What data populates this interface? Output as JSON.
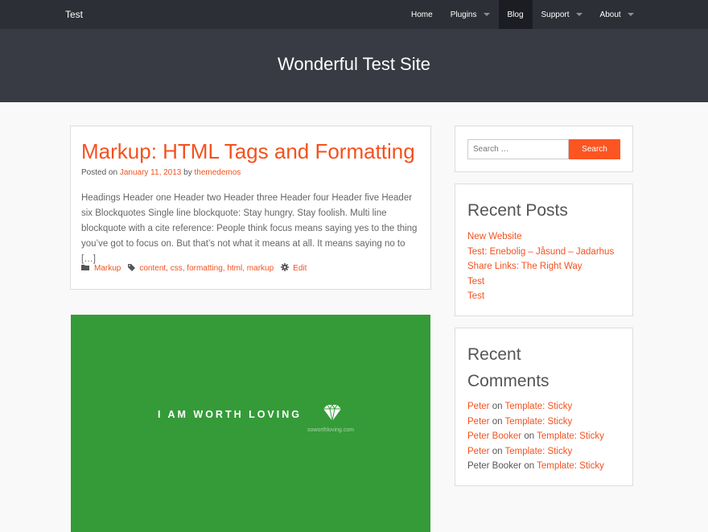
{
  "nav": {
    "brand": "Test",
    "items": [
      {
        "label": "Home",
        "caret": false,
        "active": false
      },
      {
        "label": "Plugins",
        "caret": true,
        "active": false
      },
      {
        "label": "Blog",
        "caret": false,
        "active": true
      },
      {
        "label": "Support",
        "caret": true,
        "active": false
      },
      {
        "label": "About",
        "caret": true,
        "active": false
      }
    ]
  },
  "header": {
    "title": "Wonderful Test Site"
  },
  "post": {
    "title": "Markup: HTML Tags and Formatting",
    "posted_on": "Posted on",
    "date": "January 11, 2013",
    "by": "by",
    "author": "themedemos",
    "excerpt": "Headings Header one Header two Header three Header four Header five Header six Blockquotes Single line blockquote: Stay hungry. Stay foolish. Multi line blockquote with a cite reference: People think focus means saying yes to the thing you’ve got to focus on. But that’s not what it means at all. It means saying no to […]",
    "category": "Markup",
    "tags": [
      "content",
      "css",
      "formatting",
      "html",
      "markup"
    ],
    "edit": "Edit"
  },
  "feature": {
    "text": "I AM WORTH LOVING",
    "sub": "soworthloving.com",
    "bg_color": "#349b38"
  },
  "search": {
    "placeholder": "Search …",
    "button": "Search"
  },
  "recent_posts": {
    "title": "Recent Posts",
    "items": [
      "New Website",
      "Test: Enebolig – Jåsund – Jadarhus",
      "Share Links: The Right Way",
      "Test",
      "Test"
    ]
  },
  "recent_comments": {
    "title_line1": "Recent",
    "title_line2": "Comments",
    "on": "on",
    "items": [
      {
        "author": "Peter",
        "author_link": true,
        "post": "Template: Sticky"
      },
      {
        "author": "Peter",
        "author_link": true,
        "post": "Template: Sticky"
      },
      {
        "author": "Peter Booker",
        "author_link": true,
        "post": "Template: Sticky"
      },
      {
        "author": "Peter",
        "author_link": true,
        "post": "Template: Sticky"
      },
      {
        "author": "Peter Booker",
        "author_link": false,
        "post": "Template: Sticky"
      }
    ]
  },
  "colors": {
    "accent": "#f4511e",
    "nav_bg": "#2d2f36",
    "header_bg": "#393b44"
  }
}
